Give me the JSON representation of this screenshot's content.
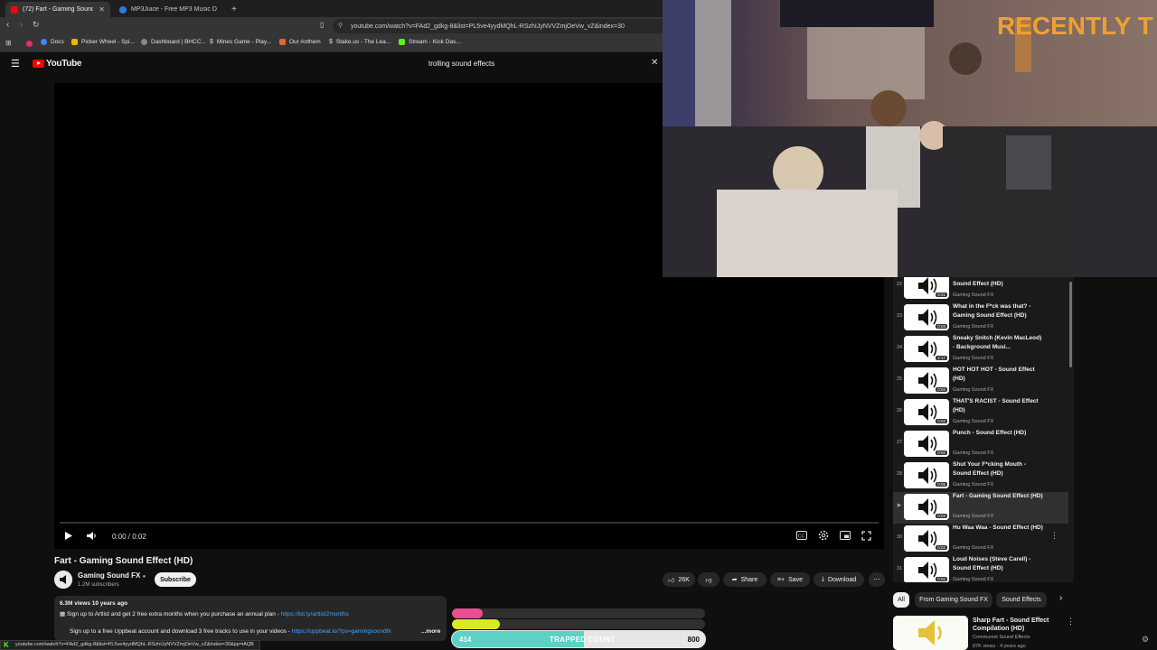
{
  "browser": {
    "tabs": [
      {
        "title": "(72) Fart - Gaming Sound E",
        "active": true
      },
      {
        "title": "MP3Juice - Free MP3 Music Down",
        "active": false
      }
    ],
    "url": "youtube.com/watch?v=FAd2_gdkg-8&list=PL5ve4yydMQhL-RSzhIJyNVVZmjOeVw_vZ&index=30",
    "bookmarks": [
      "Docs",
      "Picker Wheel - Spi...",
      "Dashboard | BHCC...",
      "Mines Game - Play...",
      "Our Anthem",
      "Stake.us - The Lea...",
      "Stream - Kick Das..."
    ],
    "status_url": "youtube.com/watch?v=FAd2_gdkg-8&list=PL5ve4yydMQhL-RSzhIJyNVVZmjOeVw_vZ&index=30&pp=iAQB"
  },
  "youtube": {
    "logo": "YouTube",
    "search_query": "trolling sound effects"
  },
  "player": {
    "time": "0:00 / 0:02"
  },
  "video": {
    "title": "Fart - Gaming Sound Effect (HD)",
    "channel": "Gaming Sound FX",
    "subscribers": "1.2M subscribers",
    "subscribe_label": "Subscribe",
    "likes": "26K",
    "share_label": "Share",
    "save_label": "Save",
    "download_label": "Download"
  },
  "description": {
    "stats": "6.3M views  10 years ago",
    "line1_text": "Sign up to Artlist and get 2 free extra months when you purchase an annual plan - ",
    "line1_link": "https://bit.ly/artlist2months",
    "line2_text": "Sign up to a free Uppbeat account and download 3 free tracks to use in your videos - ",
    "line2_link": "https://uppbeat.io/?ps=gamingsoundfx",
    "more": "...more"
  },
  "overlay": {
    "pink_fraction": 0.12,
    "yellow_fraction": 0.19,
    "trapped_label": "TRAPPED COUNT",
    "trapped_current": "414",
    "trapped_goal": "800",
    "trapped_fraction": 0.52,
    "webcam_text": "RECENTLY T"
  },
  "playlist": {
    "items": [
      {
        "index": "22",
        "title": "And His Name Is JOHN CENA - Sound Effect (HD)",
        "channel": "Gaming Sound FX",
        "duration": "0:21"
      },
      {
        "index": "23",
        "title": "What in the F*ck was that? - Gaming Sound Effect (HD)",
        "channel": "Gaming Sound FX",
        "duration": "0:03"
      },
      {
        "index": "24",
        "title": "Sneaky Snitch (Kevin MacLeod) - Background Musi...",
        "channel": "Gaming Sound FX",
        "duration": "2:17"
      },
      {
        "index": "25",
        "title": "HOT HOT HOT - Sound Effect (HD)",
        "channel": "Gaming Sound FX",
        "duration": "0:04"
      },
      {
        "index": "26",
        "title": "THAT'S RACIST - Sound Effect (HD)",
        "channel": "Gaming Sound FX",
        "duration": "0:02"
      },
      {
        "index": "27",
        "title": "Punch - Sound Effect (HD)",
        "channel": "Gaming Sound FX",
        "duration": "0:02"
      },
      {
        "index": "28",
        "title": "Shut Your F*cking Mouth - Sound Effect (HD)",
        "channel": "Gaming Sound FX",
        "duration": "0:05"
      },
      {
        "index": "▶",
        "title": "Fart - Gaming Sound Effect (HD)",
        "channel": "Gaming Sound FX",
        "duration": "0:04"
      },
      {
        "index": "30",
        "title": "Hu Waa Waa - Sound Effect (HD)",
        "channel": "Gaming Sound FX",
        "duration": "0:02"
      },
      {
        "index": "31",
        "title": "Loud Noises (Steve Carell) - Sound Effect (HD)",
        "channel": "Gaming Sound FX",
        "duration": "0:02"
      }
    ],
    "active_index": 7
  },
  "chips": [
    "All",
    "From Gaming Sound FX",
    "Sound Effects"
  ],
  "recommendation": {
    "title": "Sharp Fart - Sound Effect Compilation (HD)",
    "channel": "Communist Sound Effects",
    "meta": "87K views · 4 years ago"
  }
}
